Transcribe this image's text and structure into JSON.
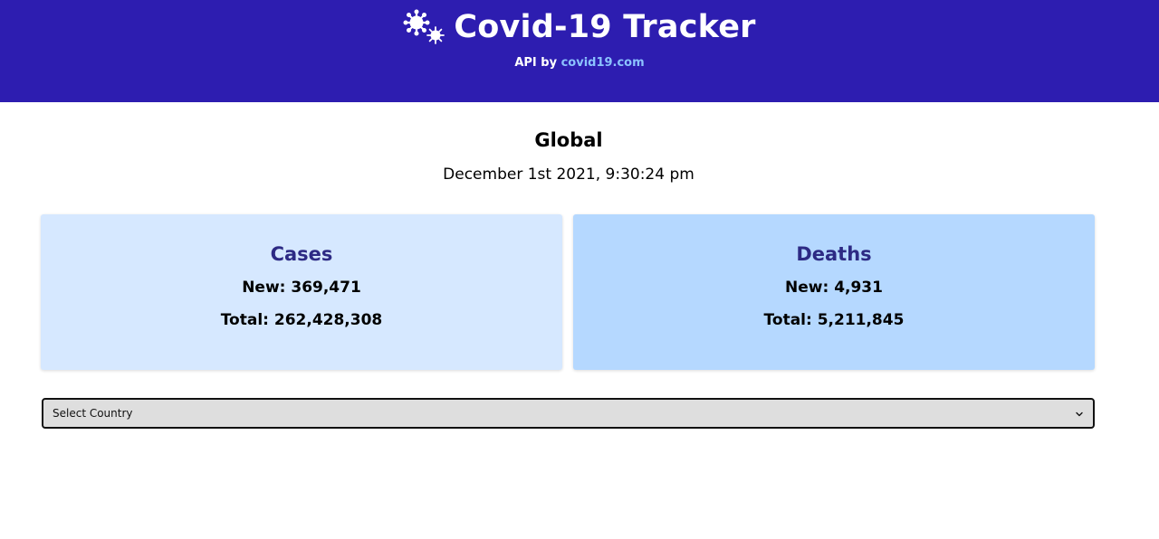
{
  "header": {
    "title": "Covid-19 Tracker",
    "icon": "virus-icon",
    "api_prefix": "API by",
    "api_link": "covid19.com",
    "background_color": "#2d1db0",
    "link_color": "#8cc3ff"
  },
  "summary": {
    "heading": "Global",
    "timestamp": "December 1st 2021, 9:30:24 pm"
  },
  "cards": {
    "cases": {
      "title": "Cases",
      "new_line": "New: 369,471",
      "total_line": "Total: 262,428,308",
      "background_color": "#d6e8ff"
    },
    "deaths": {
      "title": "Deaths",
      "new_line": "New: 4,931",
      "total_line": "Total: 5,211,845",
      "background_color": "#b5d8ff"
    }
  },
  "country_select": {
    "selected": "Select Country",
    "icon": "chevron-down-icon"
  }
}
